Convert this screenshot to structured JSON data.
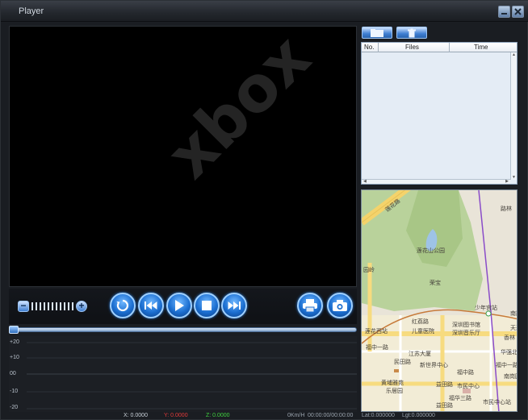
{
  "window": {
    "title": "Player"
  },
  "filelist": {
    "columns": [
      "No.",
      "Files",
      "Time"
    ],
    "rows": []
  },
  "graph": {
    "y_ticks": [
      "+20",
      "+10",
      "00",
      "-10",
      "-20"
    ]
  },
  "status": {
    "x": "X: 0.0000",
    "y": "Y: 0.0000",
    "z": "Z: 0.0000",
    "speed": "0Km/H",
    "time": "00:00:00/00:00:00",
    "lat": "Lat:0.000000",
    "lgt": "Lgt:0.000000"
  },
  "status_colors": {
    "x": "#c9d0d8",
    "y": "#e23a3a",
    "z": "#3fd23f"
  },
  "map": {
    "labels": [
      "莲花路",
      "莲花山公园",
      "园岭",
      "荣宝",
      "少年宫站",
      "红荔路",
      "莲花西站",
      "深圳图书馆",
      "深圳音乐厅",
      "儿童医院",
      "福中一路",
      "江苏大厦",
      "民田路",
      "新世界中心",
      "益田路",
      "福中路",
      "市民中心",
      "黄埔雅苑",
      "乐居园",
      "市民中心站",
      "福华三路",
      "益田路",
      "华强北",
      "路林",
      "南路",
      "香林",
      "天达大厦",
      "福中一路",
      "南岗园"
    ]
  },
  "watermark": "xbox"
}
